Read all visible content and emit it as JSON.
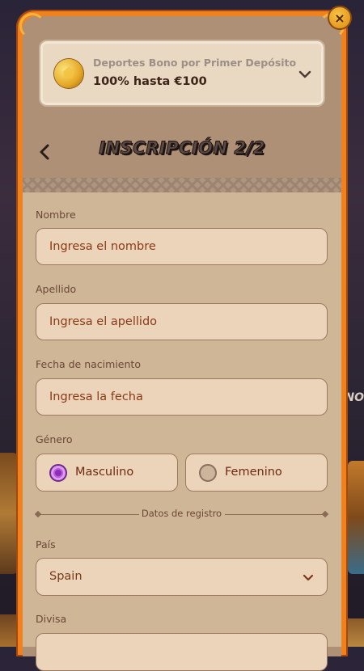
{
  "background": {
    "side_text": "NO"
  },
  "close": {
    "glyph": "×"
  },
  "bonus": {
    "label": "Deportes Bono por Primer Depósito",
    "value": "100% hasta €100",
    "icon": "soccer-ball-icon"
  },
  "header": {
    "title": "INSCRIPCIÓN 2/2",
    "back_icon": "chevron-left-icon"
  },
  "form": {
    "nombre": {
      "label": "Nombre",
      "placeholder": "Ingresa el nombre"
    },
    "apellido": {
      "label": "Apellido",
      "placeholder": "Ingresa el apellido"
    },
    "fecha": {
      "label": "Fecha de nacimiento",
      "placeholder": "Ingresa la fecha"
    },
    "genero": {
      "label": "Género",
      "options": [
        {
          "label": "Masculino",
          "selected": true
        },
        {
          "label": "Femenino",
          "selected": false
        }
      ]
    },
    "section_title": "Datos de registro",
    "pais": {
      "label": "País",
      "value": "Spain"
    },
    "divisa": {
      "label": "Divisa"
    }
  },
  "colors": {
    "accent": "#f0811f",
    "radio_selected": "#b85ed8",
    "panel": "#cfb697"
  }
}
